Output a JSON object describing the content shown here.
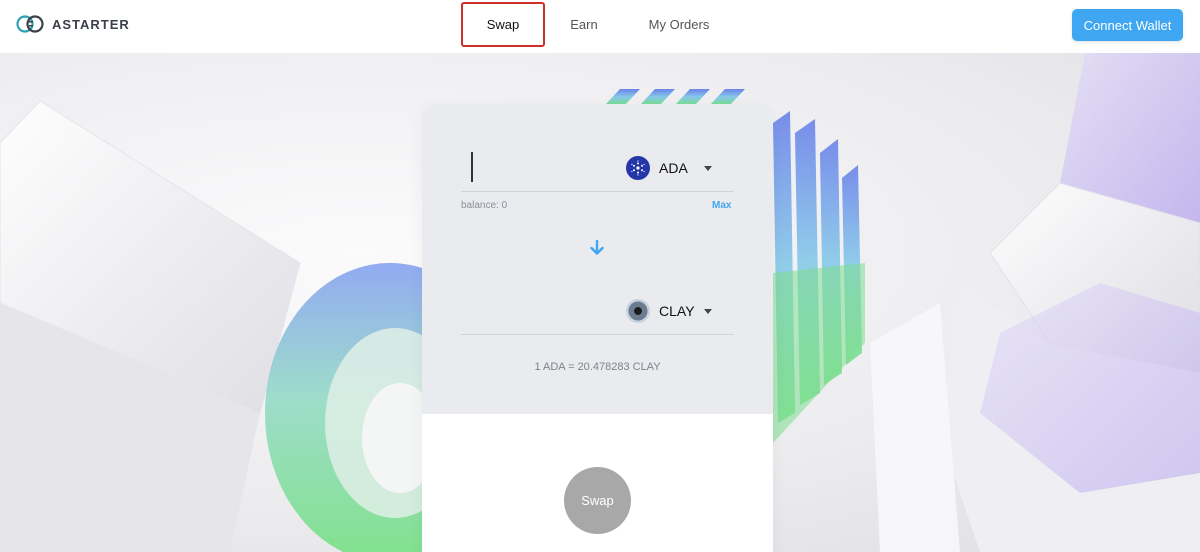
{
  "brand": {
    "name": "ASTARTER",
    "logo_icon": "astarter-logo-icon"
  },
  "nav": {
    "tabs": [
      {
        "label": "Swap",
        "active": true
      },
      {
        "label": "Earn",
        "active": false
      },
      {
        "label": "My Orders",
        "active": false
      }
    ]
  },
  "header": {
    "connect_wallet_label": "Connect Wallet"
  },
  "swap": {
    "from": {
      "value": "",
      "token": "ADA",
      "icon": "cardano-icon"
    },
    "balance_label": "balance: 0",
    "max_label": "Max",
    "direction_icon": "arrow-down-icon",
    "to": {
      "value": "",
      "token": "CLAY",
      "icon": "clay-icon"
    },
    "rate_text": "1 ADA = 20.478283 CLAY",
    "submit_label": "Swap"
  },
  "colors": {
    "accent": "#3fa6f2",
    "highlight_border": "#d0302a",
    "disabled_button": "#a8a8a8",
    "ada_blue": "#2536a8"
  }
}
